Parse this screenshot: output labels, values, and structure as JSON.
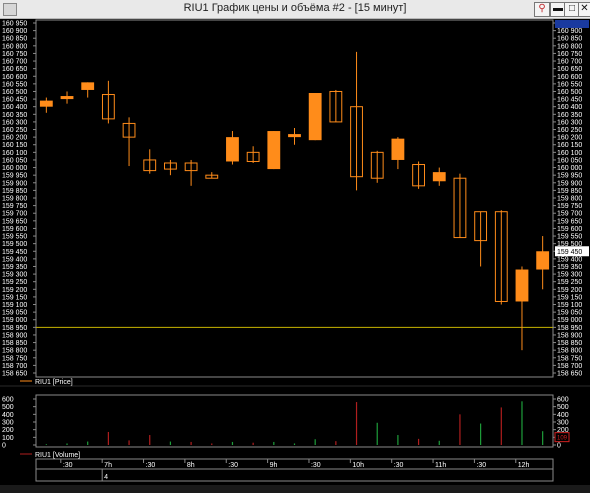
{
  "window": {
    "title": "RIU1 График цены и объёма #2 - [15 минут]",
    "buttons": {
      "pin": "⚲",
      "minimize": "▬",
      "maximize": "□",
      "close": "✕"
    }
  },
  "colors": {
    "background": "#000000",
    "grid": "#3a3a3a",
    "frame": "#8a8a8a",
    "candle": "#ff8c1a",
    "baseline": "#c8b400",
    "volume_up": "#1e9e3a",
    "volume_down": "#b01e1e",
    "text": "#ffffff",
    "current_price": "#ffffff"
  },
  "chart_data": [
    {
      "type": "candlestick",
      "title": "RIU1 [Price]",
      "ylim": [
        158650,
        160950
      ],
      "y_ticks": [
        "160 950",
        "160 900",
        "160 850",
        "160 800",
        "160 750",
        "160 700",
        "160 650",
        "160 600",
        "160 550",
        "160 500",
        "160 450",
        "160 400",
        "160 350",
        "160 300",
        "160 250",
        "160 200",
        "160 150",
        "160 100",
        "160 050",
        "160 000",
        "159 950",
        "159 900",
        "159 850",
        "159 800",
        "159 750",
        "159 700",
        "159 650",
        "159 600",
        "159 550",
        "159 500",
        "159 450",
        "159 400",
        "159 350",
        "159 300",
        "159 250",
        "159 200",
        "159 150",
        "159 100",
        "159 050",
        "159 000",
        "158 950",
        "158 900",
        "158 850",
        "158 800",
        "158 750",
        "158 700",
        "158 650"
      ],
      "baseline": 158950,
      "current_price": "159 450",
      "candles": [
        {
          "o": 160400,
          "h": 160460,
          "l": 160360,
          "c": 160440
        },
        {
          "o": 160450,
          "h": 160500,
          "l": 160420,
          "c": 160470
        },
        {
          "o": 160510,
          "h": 160560,
          "l": 160460,
          "c": 160560
        },
        {
          "o": 160480,
          "h": 160570,
          "l": 160290,
          "c": 160320
        },
        {
          "o": 160290,
          "h": 160330,
          "l": 160010,
          "c": 160200
        },
        {
          "o": 160050,
          "h": 160120,
          "l": 159960,
          "c": 159980
        },
        {
          "o": 160030,
          "h": 160050,
          "l": 159950,
          "c": 159990
        },
        {
          "o": 160030,
          "h": 160050,
          "l": 159880,
          "c": 159980
        },
        {
          "o": 159950,
          "h": 159970,
          "l": 159930,
          "c": 159930
        },
        {
          "o": 160040,
          "h": 160240,
          "l": 160020,
          "c": 160200
        },
        {
          "o": 160100,
          "h": 160140,
          "l": 160030,
          "c": 160040
        },
        {
          "o": 159990,
          "h": 160240,
          "l": 159990,
          "c": 160240
        },
        {
          "o": 160200,
          "h": 160260,
          "l": 160150,
          "c": 160220
        },
        {
          "o": 160180,
          "h": 160490,
          "l": 160180,
          "c": 160490
        },
        {
          "o": 160500,
          "h": 160510,
          "l": 160300,
          "c": 160300
        },
        {
          "o": 160400,
          "h": 160760,
          "l": 159850,
          "c": 159940
        },
        {
          "o": 160100,
          "h": 160110,
          "l": 159900,
          "c": 159930
        },
        {
          "o": 160050,
          "h": 160200,
          "l": 159990,
          "c": 160190
        },
        {
          "o": 160020,
          "h": 160040,
          "l": 159860,
          "c": 159880
        },
        {
          "o": 159910,
          "h": 160000,
          "l": 159880,
          "c": 159970
        },
        {
          "o": 159930,
          "h": 159960,
          "l": 159540,
          "c": 159540
        },
        {
          "o": 159710,
          "h": 159710,
          "l": 159350,
          "c": 159520
        },
        {
          "o": 159710,
          "h": 159720,
          "l": 159100,
          "c": 159120
        },
        {
          "o": 159120,
          "h": 159350,
          "l": 158800,
          "c": 159330
        },
        {
          "o": 159330,
          "h": 159550,
          "l": 159200,
          "c": 159450
        }
      ]
    },
    {
      "type": "bar",
      "title": "RIU1 [Volume]",
      "ylim": [
        0,
        600
      ],
      "y_ticks": [
        "600",
        "500",
        "400",
        "300",
        "200",
        "100",
        "0"
      ],
      "current_value": "109",
      "bars": [
        {
          "v": 10,
          "c": "#1e9e3a"
        },
        {
          "v": 20,
          "c": "#1e9e3a"
        },
        {
          "v": 45,
          "c": "#1e9e3a"
        },
        {
          "v": 170,
          "c": "#b01e1e"
        },
        {
          "v": 60,
          "c": "#b01e1e"
        },
        {
          "v": 130,
          "c": "#b01e1e"
        },
        {
          "v": 45,
          "c": "#1e9e3a"
        },
        {
          "v": 40,
          "c": "#b01e1e"
        },
        {
          "v": 20,
          "c": "#b01e1e"
        },
        {
          "v": 40,
          "c": "#1e9e3a"
        },
        {
          "v": 30,
          "c": "#b01e1e"
        },
        {
          "v": 40,
          "c": "#1e9e3a"
        },
        {
          "v": 20,
          "c": "#1e9e3a"
        },
        {
          "v": 75,
          "c": "#1e9e3a"
        },
        {
          "v": 50,
          "c": "#b01e1e"
        },
        {
          "v": 560,
          "c": "#b01e1e"
        },
        {
          "v": 290,
          "c": "#1e9e3a"
        },
        {
          "v": 130,
          "c": "#1e9e3a"
        },
        {
          "v": 80,
          "c": "#b01e1e"
        },
        {
          "v": 55,
          "c": "#1e9e3a"
        },
        {
          "v": 400,
          "c": "#b01e1e"
        },
        {
          "v": 280,
          "c": "#1e9e3a"
        },
        {
          "v": 490,
          "c": "#b01e1e"
        },
        {
          "v": 570,
          "c": "#1e9e3a"
        },
        {
          "v": 180,
          "c": "#1e9e3a"
        }
      ]
    }
  ],
  "time_axis": {
    "labels": [
      {
        "i": 1.2,
        "t": ":30"
      },
      {
        "i": 3.2,
        "t": "7h"
      },
      {
        "i": 5.2,
        "t": ":30"
      },
      {
        "i": 7.2,
        "t": "8h"
      },
      {
        "i": 9.2,
        "t": ":30"
      },
      {
        "i": 11.2,
        "t": "9h"
      },
      {
        "i": 13.2,
        "t": ":30"
      },
      {
        "i": 15.2,
        "t": "10h"
      },
      {
        "i": 17.2,
        "t": ":30"
      },
      {
        "i": 19.2,
        "t": "11h"
      },
      {
        "i": 21.2,
        "t": ":30"
      },
      {
        "i": 23.2,
        "t": "12h"
      }
    ],
    "date_label": {
      "i": 3.2,
      "t": "4"
    }
  }
}
